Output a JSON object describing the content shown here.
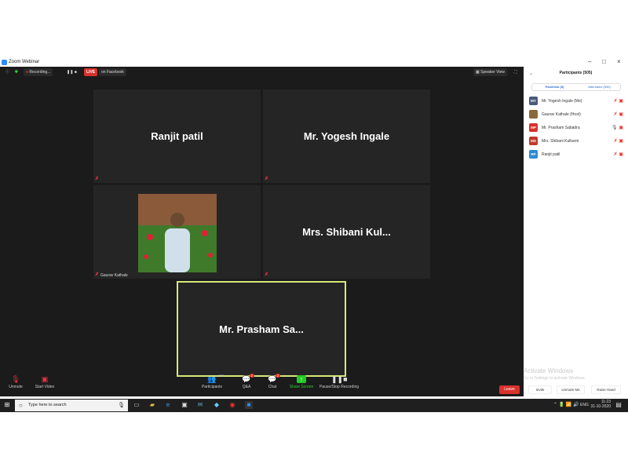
{
  "window": {
    "title": "Zoom Webinar",
    "minimize": "–",
    "maximize": "□",
    "close": "×"
  },
  "topbar": {
    "recording": "Recording...",
    "live": "LIVE",
    "live_target": "on Facebook",
    "speaker_view": "Speaker View"
  },
  "tiles": [
    {
      "label": "Ranjit patil"
    },
    {
      "label": "Mr. Yogesh Ingale"
    },
    {
      "label": "Gaurav Kathale"
    },
    {
      "label": "Mrs. Shibani Kul..."
    },
    {
      "label": "Mr. Prasham Sa..."
    }
  ],
  "controls": {
    "unmute": "Unmute",
    "start_video": "Start Video",
    "participants": "Participants",
    "participants_count": "505",
    "qa": "Q&A",
    "qa_badge": "2",
    "chat": "Chat",
    "chat_badge": "2",
    "share": "Share Screen",
    "pause": "Pause/Stop Recording",
    "leave": "Leave"
  },
  "panel": {
    "title": "Participants (505)",
    "tab_panelists": "Panelists (5)",
    "tab_attendees": "Attendees (500)",
    "participants": [
      {
        "initials": "MY",
        "name": "Mr. Yogesh Ingale  (Me)",
        "color": "#4a5a7a"
      },
      {
        "initials": "",
        "name": "Gaurav Kathale (Host)",
        "color": "#8a6a3a"
      },
      {
        "initials": "MP",
        "name": "Mr. Prasham Sabadra",
        "color": "#d9312c"
      },
      {
        "initials": "MS",
        "name": "Mrs. Shibani Kulkarni",
        "color": "#c0392b"
      },
      {
        "initials": "RP",
        "name": "Ranjit patil",
        "color": "#2d8cd8"
      }
    ],
    "invite": "Invite",
    "unmute_me": "Unmute Me",
    "raise_hand": "Raise Hand"
  },
  "watermark": {
    "title": "Activate Windows",
    "subtitle": "Go to Settings to activate Windows."
  },
  "taskbar": {
    "search_placeholder": "Type here to search",
    "time": "11:23",
    "date": "31-10-2020",
    "lang": "ENG"
  }
}
